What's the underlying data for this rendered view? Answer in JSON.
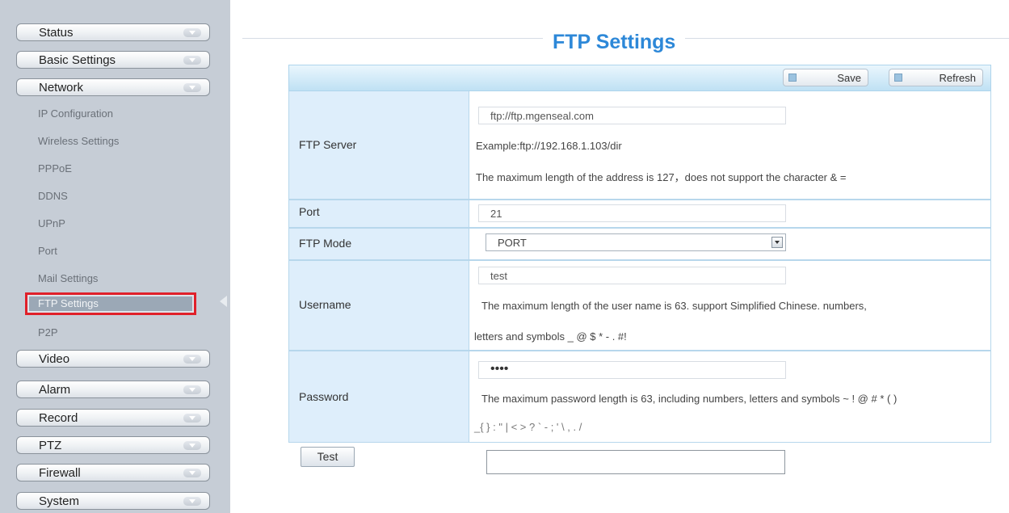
{
  "sidebar": {
    "status": "Status",
    "basic_settings": "Basic Settings",
    "network": "Network",
    "sub": {
      "ip": "IP Configuration",
      "wireless": "Wireless Settings",
      "pppoe": "PPPoE",
      "ddns": "DDNS",
      "upnp": "UPnP",
      "port": "Port",
      "mail": "Mail Settings",
      "ftp": "FTP Settings",
      "p2p": "P2P"
    },
    "video": "Video",
    "alarm": "Alarm",
    "record": "Record",
    "ptz": "PTZ",
    "firewall": "Firewall",
    "system": "System"
  },
  "page": {
    "title": "FTP Settings",
    "save_label": "Save",
    "refresh_label": "Refresh"
  },
  "form": {
    "ftp_server": {
      "label": "FTP Server",
      "value": "ftp://ftp.mgenseal.com",
      "example": "Example:ftp://192.168.1.103/dir",
      "note": "The maximum length of the address is 127，does not support the character & ="
    },
    "port": {
      "label": "Port",
      "value": "21"
    },
    "ftp_mode": {
      "label": "FTP Mode",
      "value": "PORT"
    },
    "username": {
      "label": "Username",
      "value": "test",
      "note1": "The maximum length of the user name is 63. support Simplified Chinese. numbers,",
      "note2": "letters and symbols _ @ $ * - . #!"
    },
    "password": {
      "label": "Password",
      "value": "••••",
      "note1": "The maximum password length is 63, including numbers, letters and symbols ~ ! @ # * ( )",
      "note2": "_{ } : \" | < > ? ` - ; ' \\ , . /"
    },
    "test_label": "Test",
    "test_result": ""
  }
}
